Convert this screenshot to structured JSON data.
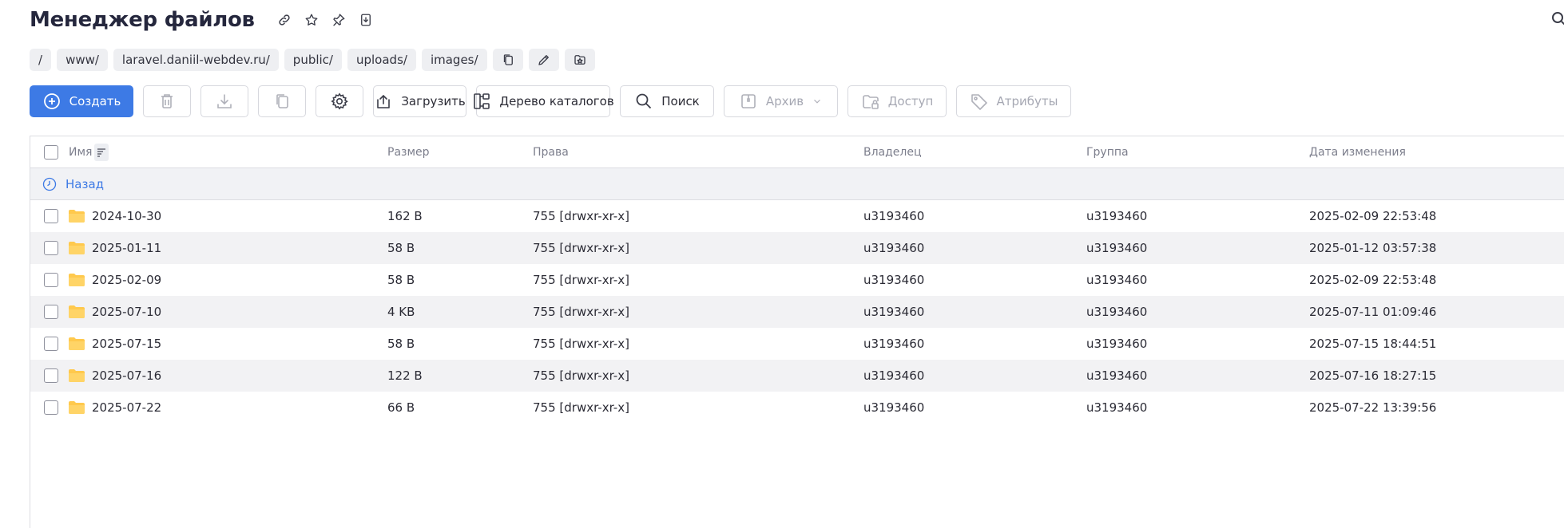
{
  "header": {
    "title": "Менеджер файлов",
    "icons": [
      "link-icon",
      "star-icon",
      "pin-icon",
      "download-doc-icon"
    ]
  },
  "breadcrumbs": {
    "items": [
      "/",
      "www/",
      "laravel.daniil-webdev.ru/",
      "public/",
      "uploads/",
      "images/"
    ],
    "actions": [
      "copy-path-icon",
      "edit-path-icon",
      "favorite-path-icon"
    ]
  },
  "toolbar": {
    "create_label": "Создать",
    "upload_label": "Загрузить",
    "tree_label": "Дерево каталогов",
    "search_label": "Поиск",
    "archive_label": "Архив",
    "access_label": "Доступ",
    "attributes_label": "Атрибуты"
  },
  "table": {
    "columns": {
      "name": "Имя",
      "size": "Размер",
      "permissions": "Права",
      "owner": "Владелец",
      "group": "Группа",
      "modified": "Дата изменения"
    },
    "back_label": "Назад",
    "rows": [
      {
        "name": "2024-10-30",
        "size": "162 B",
        "permissions": "755 [drwxr-xr-x]",
        "owner": "u3193460",
        "group": "u3193460",
        "modified": "2025-02-09 22:53:48"
      },
      {
        "name": "2025-01-11",
        "size": "58 B",
        "permissions": "755 [drwxr-xr-x]",
        "owner": "u3193460",
        "group": "u3193460",
        "modified": "2025-01-12 03:57:38"
      },
      {
        "name": "2025-02-09",
        "size": "58 B",
        "permissions": "755 [drwxr-xr-x]",
        "owner": "u3193460",
        "group": "u3193460",
        "modified": "2025-02-09 22:53:48"
      },
      {
        "name": "2025-07-10",
        "size": "4 KB",
        "permissions": "755 [drwxr-xr-x]",
        "owner": "u3193460",
        "group": "u3193460",
        "modified": "2025-07-11 01:09:46"
      },
      {
        "name": "2025-07-15",
        "size": "58 B",
        "permissions": "755 [drwxr-xr-x]",
        "owner": "u3193460",
        "group": "u3193460",
        "modified": "2025-07-15 18:44:51"
      },
      {
        "name": "2025-07-16",
        "size": "122 B",
        "permissions": "755 [drwxr-xr-x]",
        "owner": "u3193460",
        "group": "u3193460",
        "modified": "2025-07-16 18:27:15"
      },
      {
        "name": "2025-07-22",
        "size": "66 B",
        "permissions": "755 [drwxr-xr-x]",
        "owner": "u3193460",
        "group": "u3193460",
        "modified": "2025-07-22 13:39:56"
      }
    ]
  },
  "colors": {
    "primary": "#3d7ae5",
    "folder": "#ffc94d",
    "row_alt": "#f2f2f4",
    "title": "#25273d"
  }
}
